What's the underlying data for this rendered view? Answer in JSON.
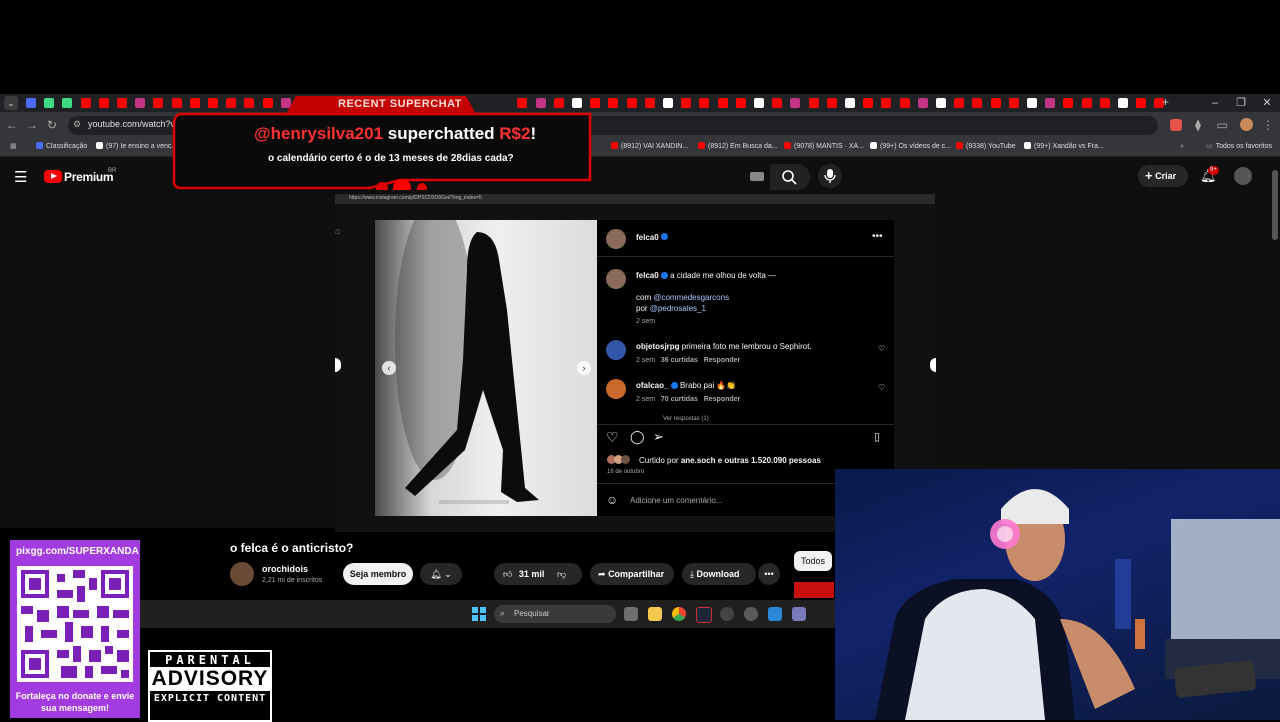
{
  "browser": {
    "url": "youtube.com/watch?v=B",
    "bookmarks": [
      {
        "label": "Classificação",
        "color": "#4a6cf7"
      },
      {
        "label": "(97) Ie ensino a venc...",
        "color": "#ffffff"
      },
      {
        "label": "(8912) VAI XANDIN...",
        "color": "#ff0000"
      },
      {
        "label": "(8912) Em Busca da...",
        "color": "#ff0000"
      },
      {
        "label": "(9078) MANTIS · XA...",
        "color": "#ff0000"
      },
      {
        "label": "(99+) Os vídeos de c...",
        "color": "#ffffff"
      },
      {
        "label": "(9338) YouTube",
        "color": "#ff0000"
      },
      {
        "label": "(99+) Xandão vs Fra...",
        "color": "#ffffff"
      }
    ],
    "all_bookmarks": "Todos os favoritos"
  },
  "superchat": {
    "header": "RECENT SUPERCHAT",
    "user": "@henrysilva201",
    "action": "superchatted",
    "amount": "R$2",
    "message": "o calendário certo é o de 13 meses de 28dias cada?"
  },
  "youtube": {
    "logo_text": "Premium",
    "region": "BR",
    "create_label": "Criar",
    "notif_count": "9+",
    "video_title": "o felca é o anticristo?",
    "channel_name": "orochidois",
    "subscribers": "2,21 mi de inscritos",
    "join_label": "Seja membro",
    "likes": "31 mil",
    "share_label": "Compartilhar",
    "download_label": "Download",
    "filter_label": "Todos"
  },
  "instagram": {
    "url": "https://www.instagram.com/p/DPSCD3O0Gei/?img_index=5",
    "username": "felca0",
    "caption": "a cidade me olhou de volta —",
    "with_prefix": "com",
    "with_handle": "@commedesgarcons",
    "by_prefix": "por",
    "by_handle": "@pedrosales_1",
    "caption_time": "2 sem",
    "comments": [
      {
        "user": "objetosjrpg",
        "text": "primeira foto me lembrou o Sephirot.",
        "time": "2 sem",
        "likes": "36 curtidas",
        "reply": "Responder"
      },
      {
        "user": "ofalcao_",
        "text": "Brabo pai 🔥👏",
        "time": "2 sem",
        "likes": "70 curtidas",
        "reply": "Responder"
      }
    ],
    "view_replies": "Ver respostas (1)",
    "liked_by_prefix": "Curtido por",
    "liked_by_user": "ane.soch",
    "liked_by_suffix": "e outras 1.520.090 pessoas",
    "date": "16 de outubro",
    "add_comment_placeholder": "Adicione um comentário..."
  },
  "taskbar": {
    "search_placeholder": "Pesquisar"
  },
  "donate": {
    "url": "pixgg.com/SUPERXANDA",
    "message": "Fortaleça no donate e envie sua mensagem!"
  },
  "advisory": {
    "line1": "PARENTAL",
    "line2": "ADVISORY",
    "line3": "EXPLICIT CONTENT"
  }
}
